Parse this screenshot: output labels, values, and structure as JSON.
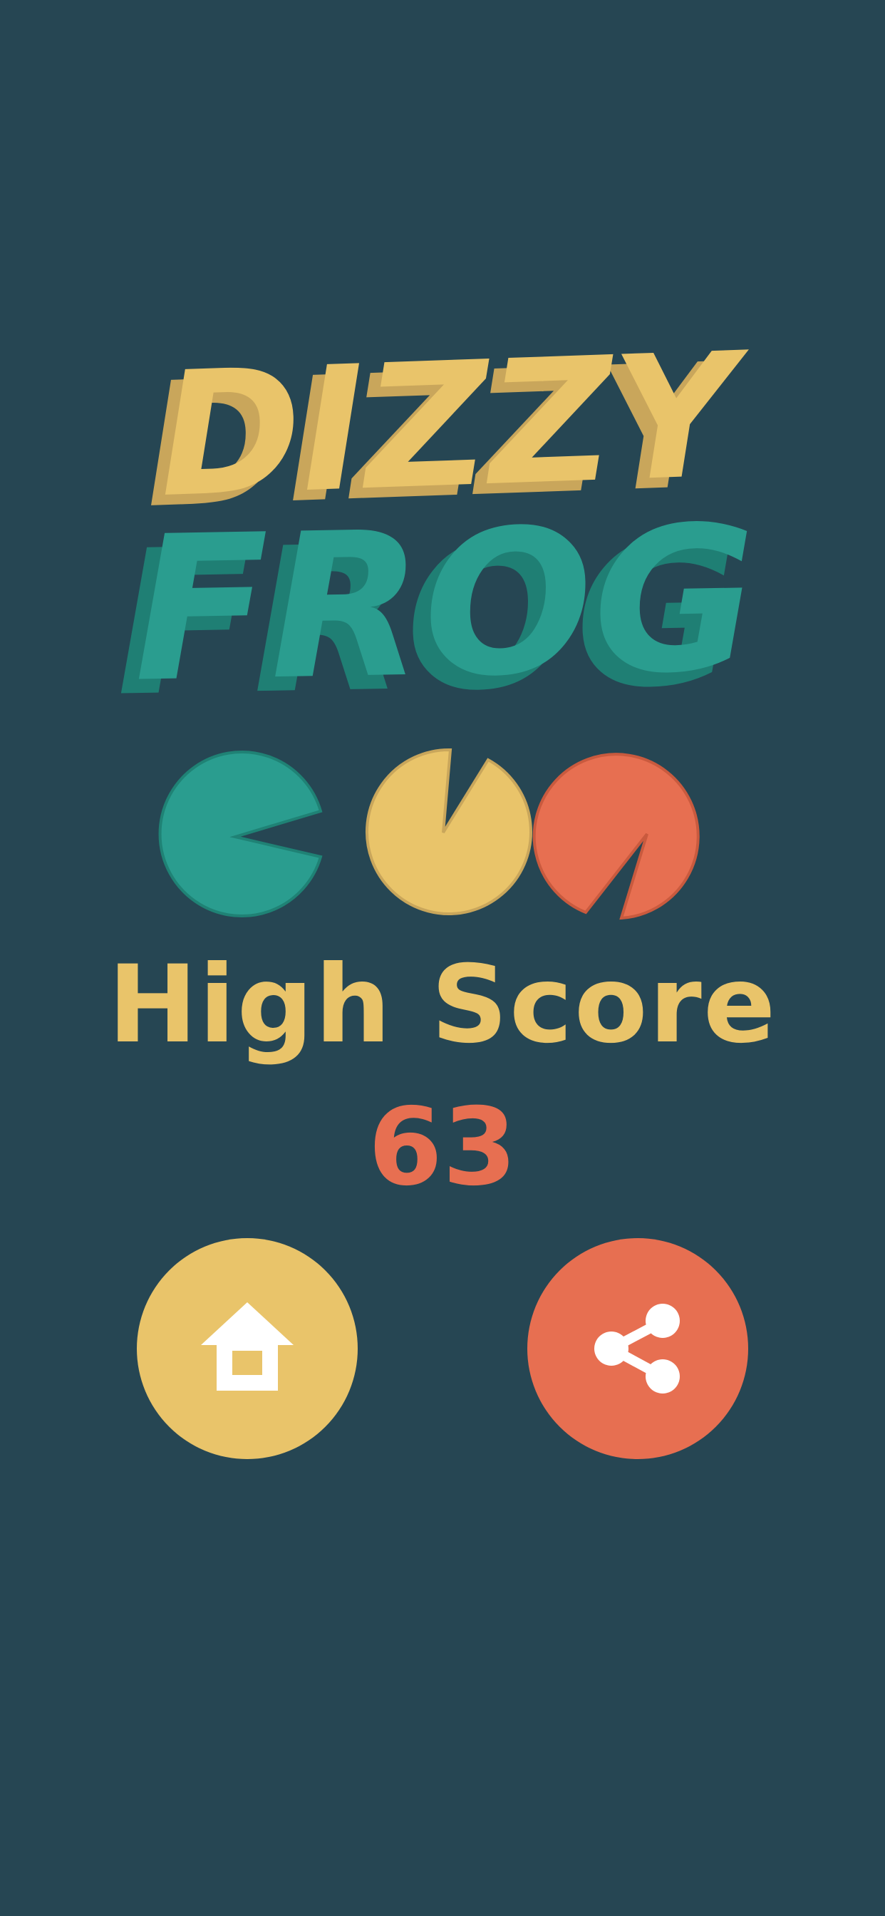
{
  "game": {
    "title_line1": "DIZZY",
    "title_line2": "FROG"
  },
  "score": {
    "label": "High Score",
    "value": "63"
  },
  "buttons": {
    "home_icon": "home-icon",
    "share_icon": "share-icon"
  },
  "colors": {
    "background": "#264653",
    "teal": "#2A9D8F",
    "yellow": "#E9C46A",
    "coral": "#E76F51",
    "white": "#FFFFFF"
  }
}
